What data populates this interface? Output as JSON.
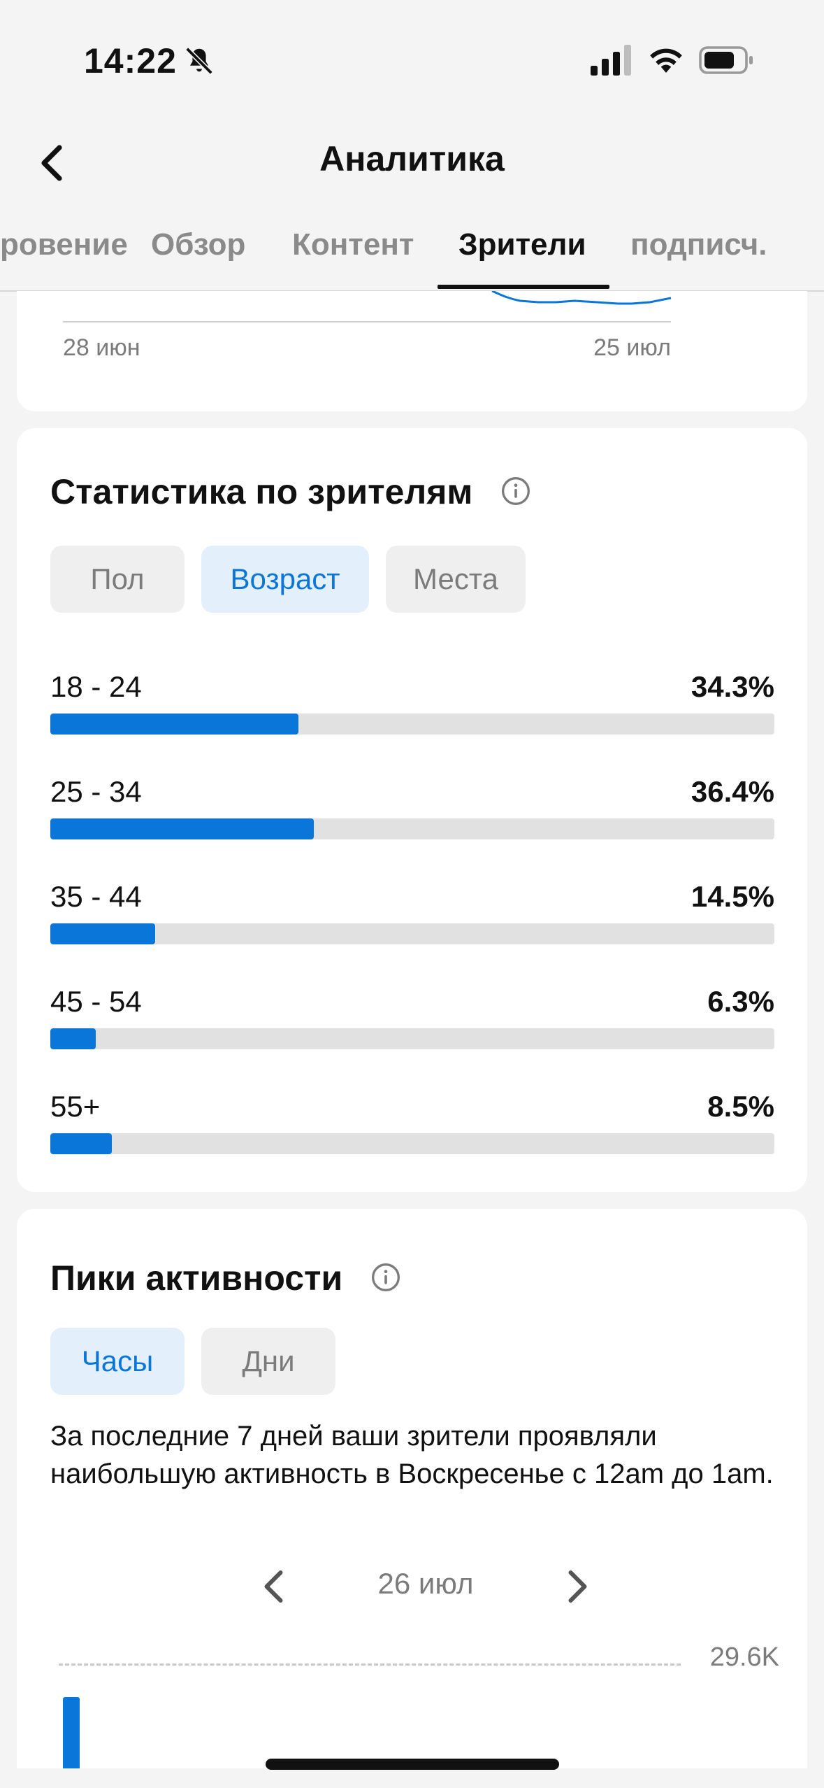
{
  "status_bar": {
    "time": "14:22",
    "icons": [
      "bell-off-icon",
      "cellular-signal-icon",
      "wifi-icon",
      "battery-icon"
    ]
  },
  "header": {
    "title": "Аналитика",
    "back_icon": "chevron-left-icon"
  },
  "tabs": [
    {
      "label": "ровение",
      "active": false
    },
    {
      "label": "Обзор",
      "active": false
    },
    {
      "label": "Контент",
      "active": false
    },
    {
      "label": "Зрители",
      "active": true
    },
    {
      "label": "подписч.",
      "active": false
    }
  ],
  "top_chart": {
    "x_start_label": "28 июн",
    "x_end_label": "25 июл"
  },
  "viewer_stats": {
    "title": "Статистика по зрителям",
    "info_icon": "info-icon",
    "filters": [
      {
        "label": "Пол",
        "selected": false
      },
      {
        "label": "Возраст",
        "selected": true
      },
      {
        "label": "Места",
        "selected": false
      }
    ],
    "age_groups": [
      {
        "label": "18 - 24",
        "value": "34.3%",
        "percent": 34.3
      },
      {
        "label": "25 - 34",
        "value": "36.4%",
        "percent": 36.4
      },
      {
        "label": "35 - 44",
        "value": "14.5%",
        "percent": 14.5
      },
      {
        "label": "45 - 54",
        "value": "6.3%",
        "percent": 6.3
      },
      {
        "label": "55+",
        "value": "8.5%",
        "percent": 8.5
      }
    ]
  },
  "peaks": {
    "title": "Пики активности",
    "info_icon": "info-icon",
    "filters": [
      {
        "label": "Часы",
        "selected": true
      },
      {
        "label": "Дни",
        "selected": false
      }
    ],
    "description": "За последние 7 дней ваши зрители проявляли наибольшую активность в Воскресенье с 12am до 1am.",
    "date": "26 июл",
    "max_label": "29.6K"
  },
  "colors": {
    "accent": "#0a76da",
    "track": "#e1e1e1",
    "background": "#f4f4f4"
  }
}
